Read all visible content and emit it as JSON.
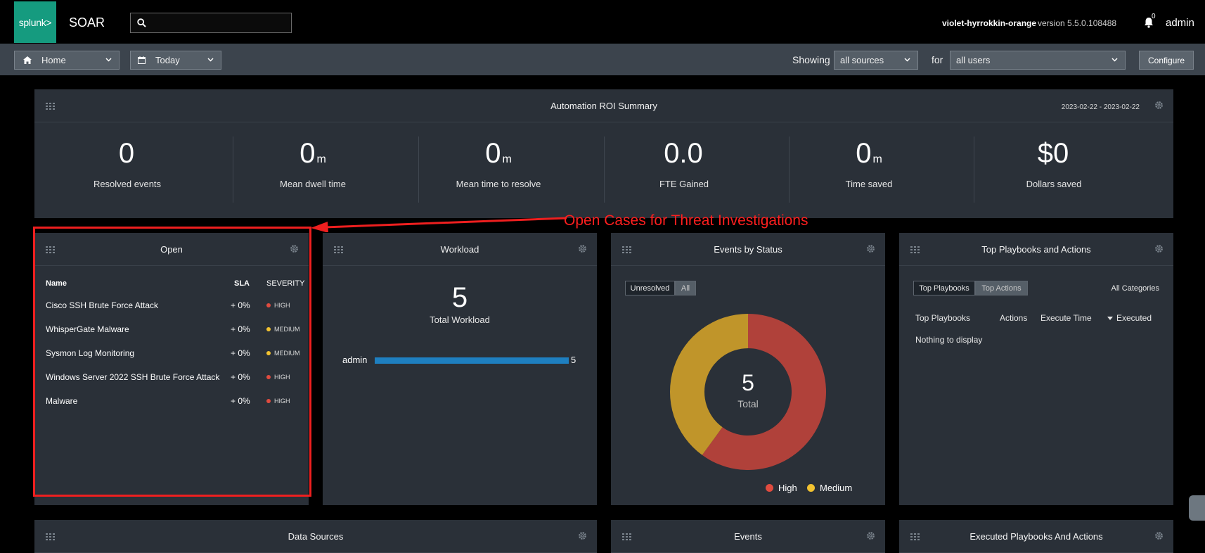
{
  "header": {
    "logo_text": "splunk>",
    "app_title": "SOAR",
    "search_icon": "search-icon",
    "hostname": "violet-hyrrokkin-orange",
    "version": "version 5.5.0.108488",
    "notification_count": "0",
    "username": "admin"
  },
  "filters": {
    "home_label": "Home",
    "date_label": "Today",
    "showing_label": "Showing",
    "sources_value": "all sources",
    "for_label": "for",
    "users_value": "all users",
    "configure_label": "Configure"
  },
  "roi": {
    "title": "Automation ROI Summary",
    "date_range": "2023-02-22 - 2023-02-22",
    "metrics": [
      {
        "value": "0",
        "unit": "",
        "label": "Resolved events"
      },
      {
        "value": "0",
        "unit": "m",
        "label": "Mean dwell time"
      },
      {
        "value": "0",
        "unit": "m",
        "label": "Mean time to resolve"
      },
      {
        "value": "0.0",
        "unit": "",
        "label": "FTE Gained"
      },
      {
        "value": "0",
        "unit": "m",
        "label": "Time saved"
      },
      {
        "value": "$0",
        "unit": "",
        "label": "Dollars saved"
      }
    ]
  },
  "open_panel": {
    "title": "Open",
    "col_name": "Name",
    "col_sla": "SLA",
    "col_severity": "SEVERITY",
    "rows": [
      {
        "name": "Cisco SSH Brute Force Attack",
        "sla": "+ 0%",
        "severity": "HIGH"
      },
      {
        "name": "WhisperGate Malware",
        "sla": "+ 0%",
        "severity": "MEDIUM"
      },
      {
        "name": "Sysmon Log Monitoring",
        "sla": "+ 0%",
        "severity": "MEDIUM"
      },
      {
        "name": "Windows Server 2022 SSH Brute Force Attack",
        "sla": "+ 0%",
        "severity": "HIGH"
      },
      {
        "name": "Malware",
        "sla": "+ 0%",
        "severity": "HIGH"
      }
    ]
  },
  "annotation": {
    "text": "Open Cases for Threat Investigations",
    "color": "#ee1f1f"
  },
  "workload": {
    "title": "Workload",
    "total": "5",
    "total_label": "Total Workload",
    "bars": [
      {
        "user": "admin",
        "value": "5"
      }
    ]
  },
  "events_by_status": {
    "title": "Events by Status",
    "toggle_unresolved": "Unresolved",
    "toggle_all": "All",
    "total": "5",
    "total_label": "Total",
    "legend_high": "High",
    "legend_medium": "Medium"
  },
  "top_playbooks": {
    "title": "Top Playbooks and Actions",
    "tab_playbooks": "Top Playbooks",
    "tab_actions": "Top Actions",
    "category": "All Categories",
    "col_playbooks": "Top Playbooks",
    "col_actions": "Actions",
    "col_execute_time": "Execute Time",
    "col_executed": "Executed",
    "empty": "Nothing to display"
  },
  "bottom_panels": {
    "data_sources": "Data Sources",
    "events": "Events",
    "executed": "Executed Playbooks And Actions"
  },
  "colors": {
    "high": "#b0413a",
    "medium": "#c0952a",
    "high_dot": "#e04b3f",
    "medium_dot": "#f2c230",
    "accent": "#159b7f",
    "bar": "#1e7fc0"
  },
  "chart_data": {
    "type": "pie",
    "categories": [
      "High",
      "Medium"
    ],
    "values": [
      3,
      2
    ],
    "total": 5
  }
}
